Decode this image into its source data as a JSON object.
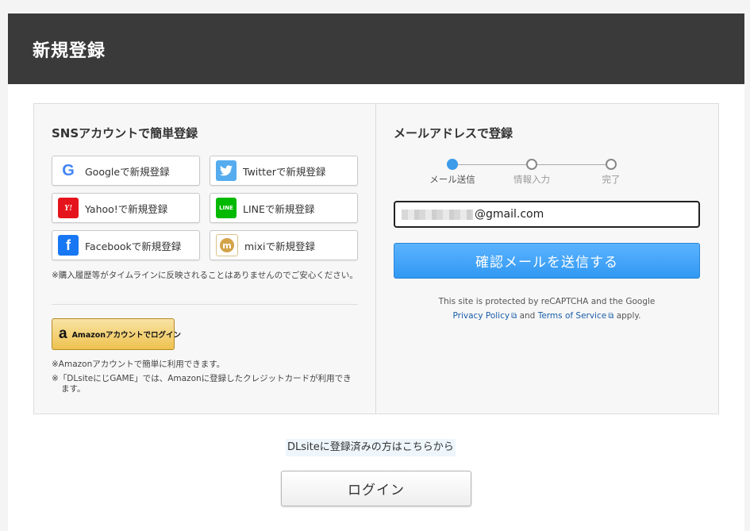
{
  "header": {
    "title": "新規登録"
  },
  "sns": {
    "title": "SNSアカウントで簡単登録",
    "buttons": [
      {
        "icon": "google-icon",
        "glyph": "G",
        "label": "Googleで新規登録"
      },
      {
        "icon": "twitter-icon",
        "glyph": "🐦",
        "label": "Twitterで新規登録"
      },
      {
        "icon": "yahoo-icon",
        "glyph": "Y!",
        "label": "Yahoo!で新規登録"
      },
      {
        "icon": "line-icon",
        "glyph": "LINE",
        "label": "LINEで新規登録"
      },
      {
        "icon": "facebook-icon",
        "glyph": "f",
        "label": "Facebookで新規登録"
      },
      {
        "icon": "mixi-icon",
        "glyph": "m",
        "label": "mixiで新規登録"
      }
    ],
    "note": "※購入履歴等がタイムラインに反映されることはありませんのでご安心ください。",
    "amazon_button": {
      "icon": "amazon-icon",
      "glyph": "a",
      "label": "Amazonアカウントでログイン"
    },
    "amazon_note_1": "※Amazonアカウントで簡単に利用できます。",
    "amazon_note_2": "※「DLsiteにじGAME」では、Amazonに登録したクレジットカードが利用できます。"
  },
  "mail": {
    "title": "メールアドレスで登録",
    "steps": [
      {
        "label": "メール送信",
        "active": true
      },
      {
        "label": "情報入力",
        "active": false
      },
      {
        "label": "完了",
        "active": false
      }
    ],
    "email_value": "@gmail.com",
    "send_button": "確認メールを送信する",
    "recaptcha_text_1": "This site is protected by reCAPTCHA and the Google",
    "privacy_link": "Privacy Policy",
    "and_text": "and",
    "terms_link": "Terms of Service",
    "apply_text": "apply."
  },
  "footer": {
    "login_link": "DLsiteに登録済みの方はこちらから",
    "login_button": "ログイン"
  },
  "colors": {
    "header_bg": "#3a3a3a",
    "accent_blue": "#3198f2",
    "active_step": "#3d9be9"
  }
}
